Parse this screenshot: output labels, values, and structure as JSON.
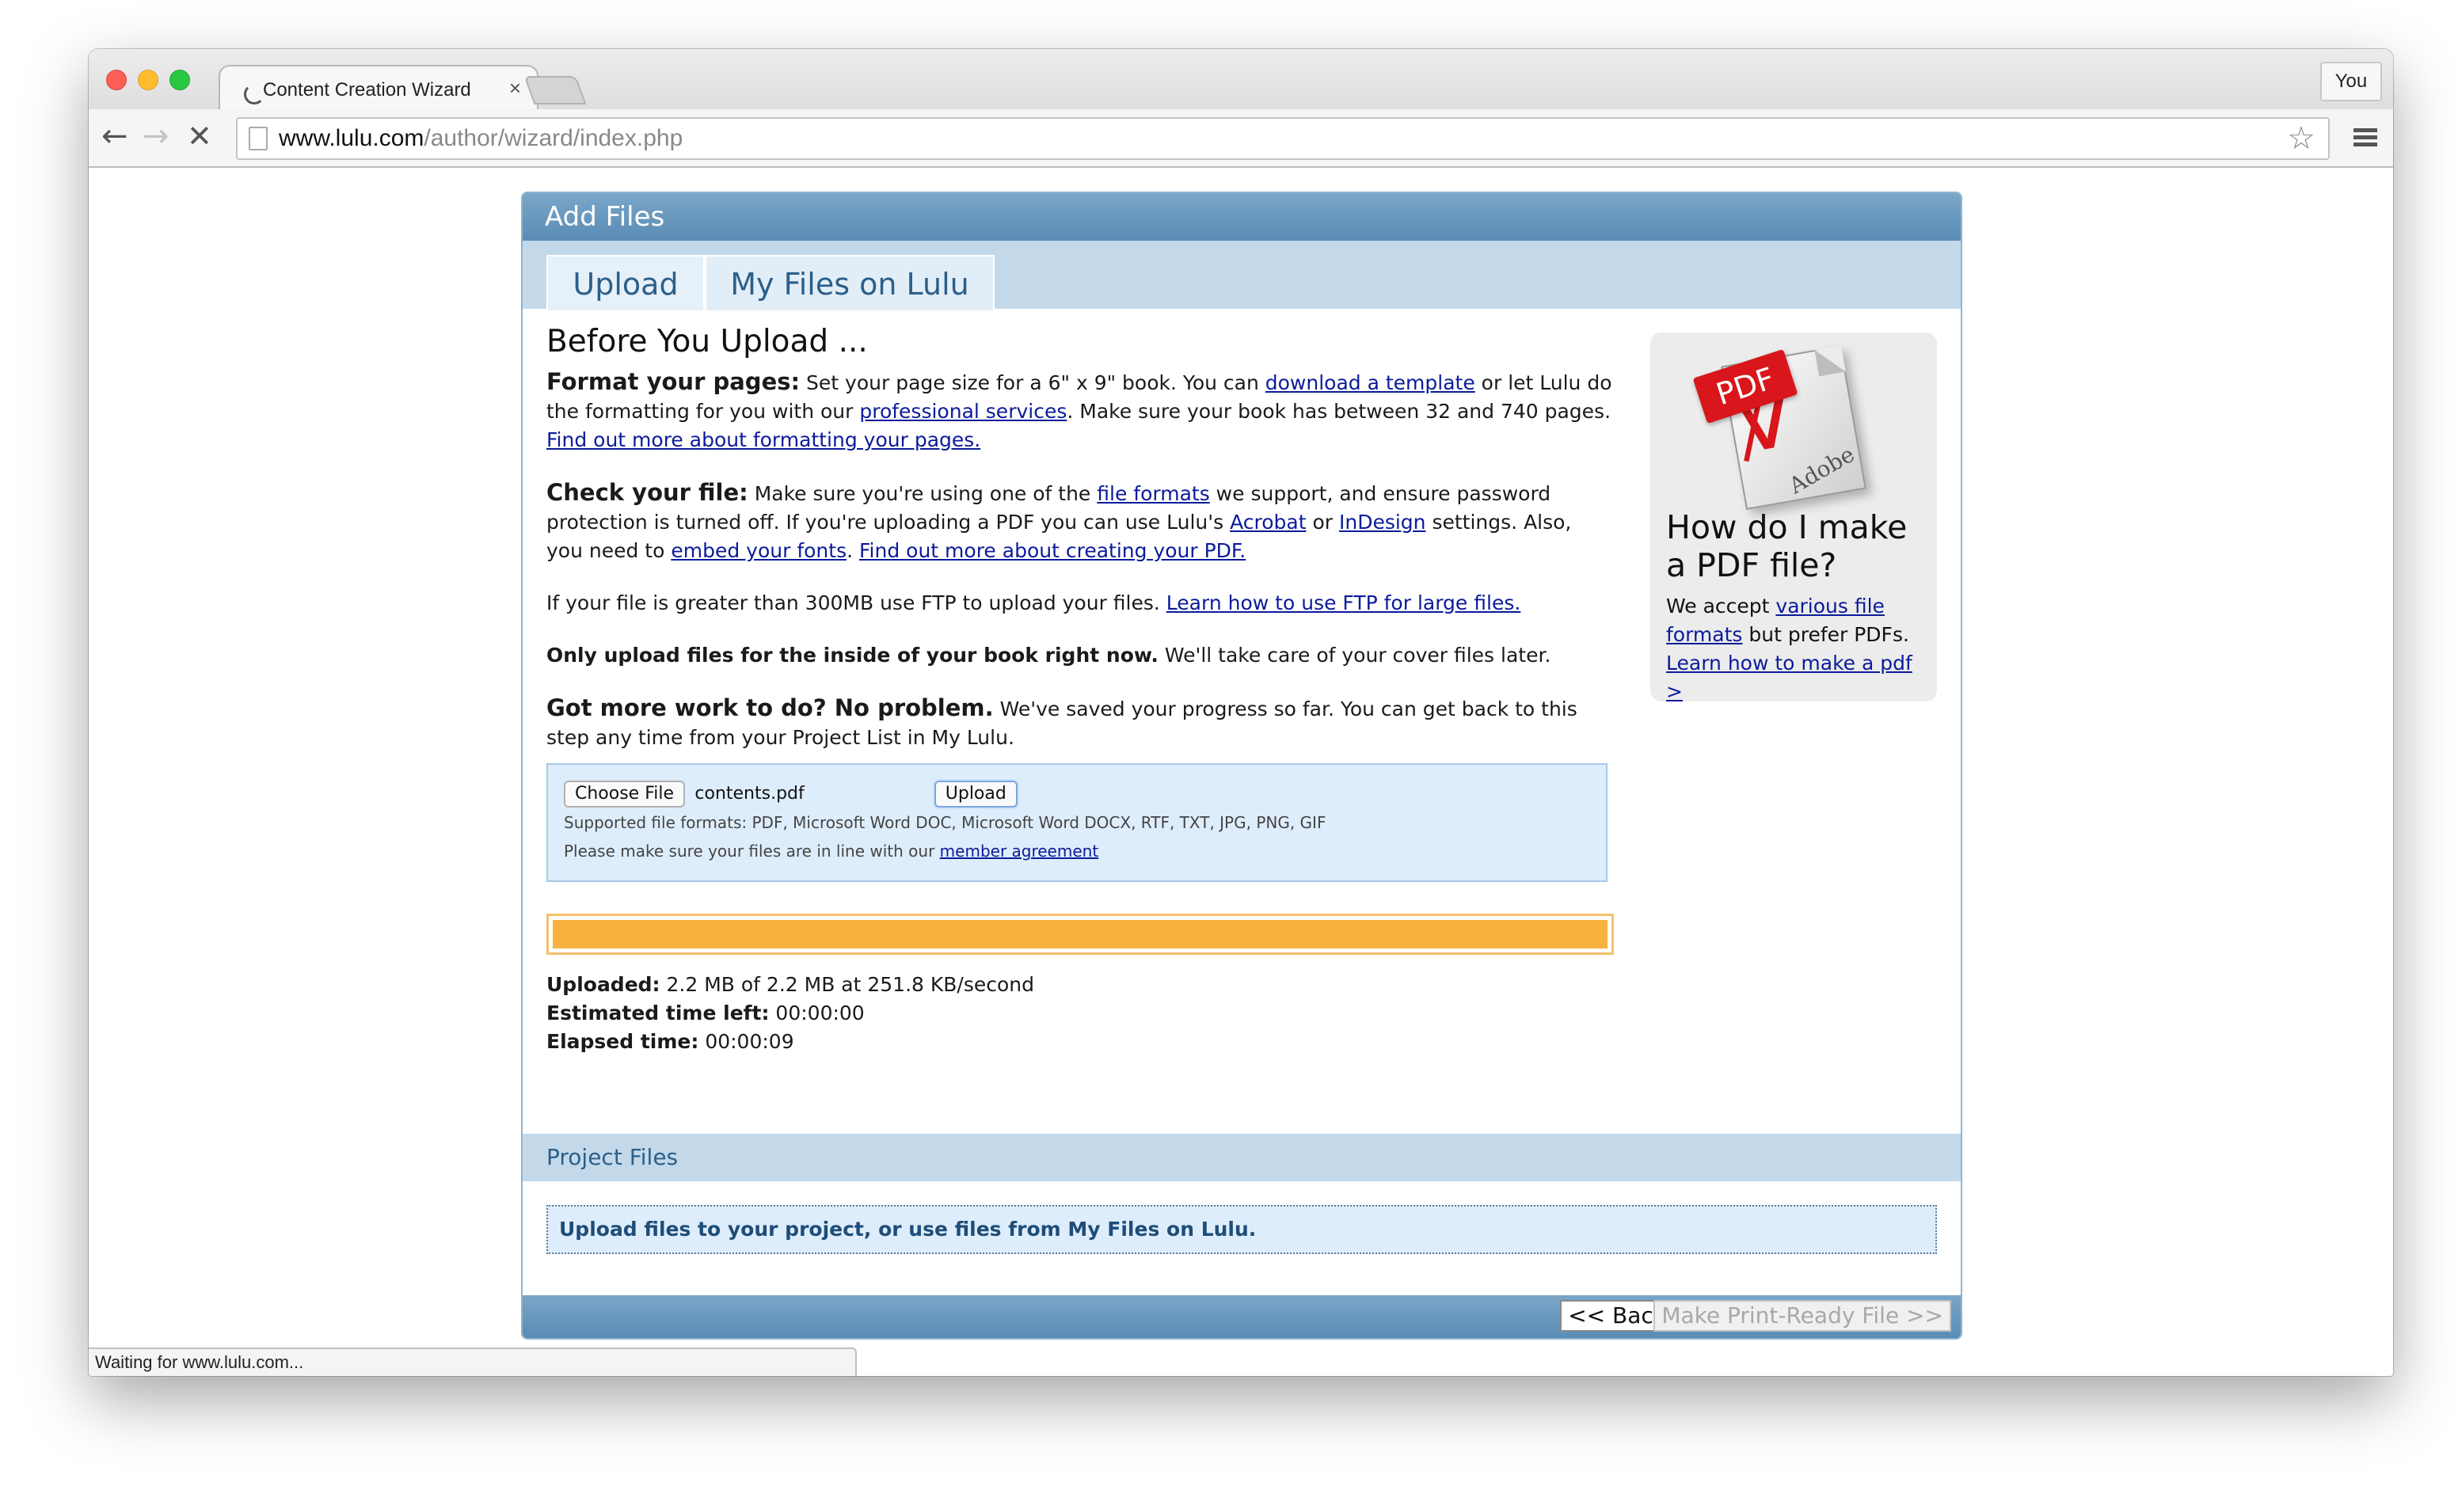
{
  "browser": {
    "tab_title": "Content Creation Wizard",
    "tab_close": "×",
    "user_button": "You",
    "url_host": "www.lulu.com",
    "url_path": "/author/wizard/index.php",
    "status_text": "Waiting for www.lulu.com...",
    "icons": [
      "back-arrow-icon",
      "forward-arrow-icon",
      "stop-icon",
      "page-icon",
      "star-icon",
      "menu-icon",
      "loading-spinner-icon"
    ]
  },
  "wizard": {
    "header": "Add Files",
    "tabs": [
      {
        "label": "Upload",
        "active": true
      },
      {
        "label": "My Files on Lulu",
        "active": false
      }
    ],
    "heading": "Before You Upload ...",
    "format": {
      "lead": "Format your pages:",
      "t1": " Set your page size for a 6\" x 9\" book. You can ",
      "link1": "download a template",
      "t2": " or let Lulu do the formatting for you with our ",
      "link2": "professional services",
      "t3": ". Make sure your book has between 32 and 740 pages. ",
      "link3": "Find out more about formatting your pages."
    },
    "check": {
      "lead": "Check your file:",
      "t1": " Make sure you're using one of the ",
      "link1": "file formats",
      "t2": " we support, and ensure password protection is turned off. If you're uploading a PDF you can use Lulu's ",
      "link2": "Acrobat",
      "t3": " or ",
      "link3": "InDesign",
      "t4": " settings. Also, you need to ",
      "link4": "embed your fonts",
      "t5": ". ",
      "link5": "Find out more about creating your PDF."
    },
    "ftp": {
      "t1": "If your file is greater than 300MB use FTP to upload your files. ",
      "link": "Learn how to use FTP for large files."
    },
    "only": {
      "lead": "Only upload files for the inside of your book right now.",
      "t1": " We'll take care of your cover files later."
    },
    "more": {
      "lead": "Got more work to do? No problem.",
      "t1": " We've saved your progress so far. You can get back to this step any time from your Project List in My Lulu."
    },
    "upload_box": {
      "choose_button": "Choose File",
      "file_name": "contents.pdf",
      "upload_button": "Upload",
      "formats": "Supported file formats: PDF, Microsoft Word DOC, Microsoft Word DOCX, RTF, TXT, JPG, PNG, GIF",
      "agree_text": "Please make sure your files are in line with our ",
      "agree_link": "member agreement"
    },
    "progress": {
      "fraction": 1.0,
      "color": "#f8b03f"
    },
    "stats": {
      "uploaded_label": "Uploaded:",
      "uploaded_value": " 2.2 MB of 2.2 MB at 251.8 KB/second",
      "est_label": "Estimated time left:",
      "est_value": " 00:00:00",
      "elapsed_label": "Elapsed time:",
      "elapsed_value": " 00:00:09"
    },
    "sidebar": {
      "pdf_badge": "PDF",
      "pdf_brand": "Adobe",
      "title": "How do I make a PDF file?",
      "t1": "We accept ",
      "link1": "various file formats",
      "t2": " but prefer PDFs.",
      "link2": "Learn how to make a pdf >"
    },
    "project_files": {
      "header": "Project Files",
      "message": "Upload files to your project, or use files from My Files on Lulu."
    },
    "footer": {
      "back_button": "<< Back",
      "next_button": "Make Print-Ready File >>"
    }
  },
  "colors": {
    "header_blue": "#5a8cb5",
    "panel_blue": "#c3d9ea",
    "link": "#0b1b9a",
    "progress_fill": "#f8b03f"
  }
}
